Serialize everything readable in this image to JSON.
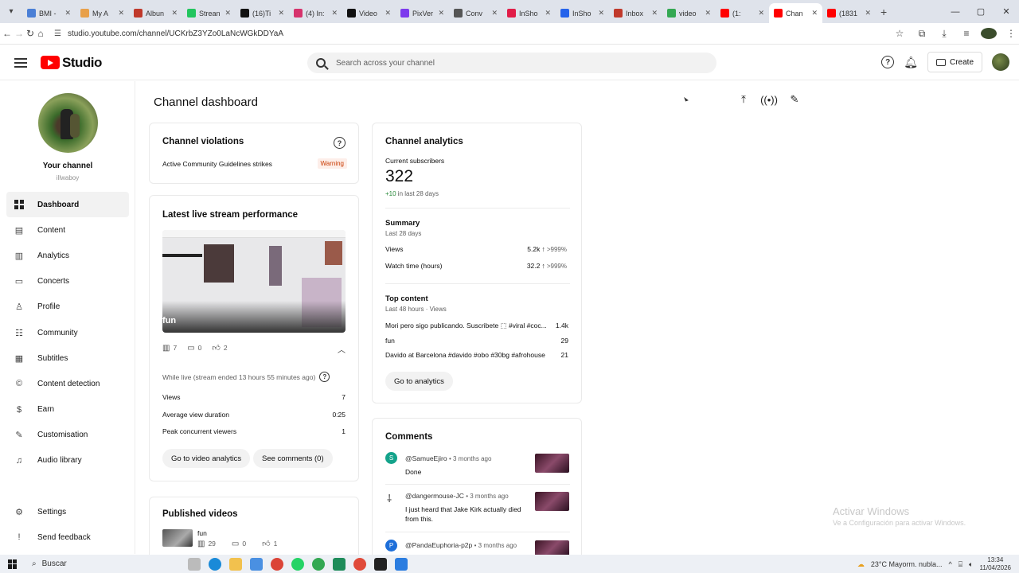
{
  "browser": {
    "tabs": [
      {
        "label": "BMI -",
        "color": "#4a7fd6",
        "active": false
      },
      {
        "label": "My A",
        "color": "#e8a04a",
        "active": false
      },
      {
        "label": "Albun",
        "color": "#c0392b",
        "active": false
      },
      {
        "label": "Strean",
        "color": "#22c55e",
        "active": false
      },
      {
        "label": "(16)Ti",
        "color": "#111111",
        "active": false
      },
      {
        "label": "(4) In:",
        "color": "#d6336c",
        "active": false
      },
      {
        "label": "Video",
        "color": "#111111",
        "active": false
      },
      {
        "label": "PixVer",
        "color": "#7c3aed",
        "active": false
      },
      {
        "label": "Conv",
        "color": "#555555",
        "active": false
      },
      {
        "label": "InSho",
        "color": "#e11d48",
        "active": false
      },
      {
        "label": "InSho",
        "color": "#2563eb",
        "active": false
      },
      {
        "label": "Inbox",
        "color": "#c0392b",
        "active": false
      },
      {
        "label": "video",
        "color": "#34a853",
        "active": false
      },
      {
        "label": "(1:",
        "color": "#ff0000",
        "active": false
      },
      {
        "label": "Chan",
        "color": "#ff0000",
        "active": true
      },
      {
        "label": "(1831",
        "color": "#ff0000",
        "active": false
      }
    ],
    "url": "studio.youtube.com/channel/UCKrbZ3YZo0LaNcWGkDDYaA"
  },
  "header": {
    "logo_text": "Studio",
    "search_placeholder": "Search across your channel",
    "create_label": "Create"
  },
  "sidebar": {
    "channel_label": "Your channel",
    "handle": "illwaboy",
    "items": [
      {
        "label": "Dashboard",
        "icon": "dashboard-icon",
        "glyph": "",
        "active": true
      },
      {
        "label": "Content",
        "icon": "content-icon",
        "glyph": "▤",
        "active": false
      },
      {
        "label": "Analytics",
        "icon": "analytics-icon",
        "glyph": "▥",
        "active": false
      },
      {
        "label": "Concerts",
        "icon": "concerts-icon",
        "glyph": "▭",
        "active": false
      },
      {
        "label": "Profile",
        "icon": "profile-icon",
        "glyph": "♙",
        "active": false
      },
      {
        "label": "Community",
        "icon": "community-icon",
        "glyph": "☷",
        "active": false
      },
      {
        "label": "Subtitles",
        "icon": "subtitles-icon",
        "glyph": "▦",
        "active": false
      },
      {
        "label": "Content detection",
        "icon": "copyright-icon",
        "glyph": "©",
        "active": false
      },
      {
        "label": "Earn",
        "icon": "earn-icon",
        "glyph": "$",
        "active": false
      },
      {
        "label": "Customisation",
        "icon": "customisation-icon",
        "glyph": "✎",
        "active": false
      },
      {
        "label": "Audio library",
        "icon": "audio-library-icon",
        "glyph": "♫",
        "active": false
      }
    ],
    "bottom_items": [
      {
        "label": "Settings",
        "icon": "settings-icon",
        "glyph": "⚙"
      },
      {
        "label": "Send feedback",
        "icon": "feedback-icon",
        "glyph": "!"
      }
    ]
  },
  "main": {
    "title": "Channel dashboard",
    "violations": {
      "title": "Channel violations",
      "text": "Active Community Guidelines strikes",
      "badge": "Warning"
    },
    "live": {
      "title": "Latest live stream performance",
      "thumb_label": "fun",
      "views_count": "7",
      "comments_count": "0",
      "likes_count": "2",
      "while_live": "While live (stream ended 13 hours 55 minutes ago)",
      "rows": [
        {
          "label": "Views",
          "value": "7"
        },
        {
          "label": "Average view duration",
          "value": "0:25"
        },
        {
          "label": "Peak concurrent viewers",
          "value": "1"
        }
      ],
      "btn_analytics": "Go to video analytics",
      "btn_comments": "See comments (0)"
    },
    "published": {
      "title": "Published videos",
      "video_title": "fun",
      "views": "29",
      "comments": "0",
      "likes": "1"
    },
    "analytics": {
      "title": "Channel analytics",
      "subs_label": "Current subscribers",
      "subs_value": "322",
      "subs_change": "+10",
      "subs_change_suffix": " in last 28 days",
      "summary_title": "Summary",
      "summary_sub": "Last 28 days",
      "summary_rows": [
        {
          "label": "Views",
          "value": "5.2k",
          "change": ">999%"
        },
        {
          "label": "Watch time (hours)",
          "value": "32.2",
          "change": ">999%"
        }
      ],
      "top_title": "Top content",
      "top_sub": "Last 48 hours · Views",
      "top_rows": [
        {
          "label": "Mori pero sigo publicando. Suscribete ⬚ #viral #coc...",
          "value": "1.4k"
        },
        {
          "label": "fun",
          "value": "29"
        },
        {
          "label": "Davido at Barcelona #davido #obo #30bg #afrohouse",
          "value": "21"
        }
      ],
      "btn": "Go to analytics"
    },
    "comments": {
      "title": "Comments",
      "items": [
        {
          "initial": "S",
          "color": "#14a38b",
          "user": "@SamueEjiro",
          "time": "• 3 months ago",
          "text": "Done"
        },
        {
          "initial": "",
          "color": "#ffffff",
          "user": "@dangermouse-JC",
          "time": "• 3 months ago",
          "text": "I just heard that Jake Kirk actually died from this."
        },
        {
          "initial": "P",
          "color": "#1e6fd9",
          "user": "@PandaEuphoria-p2p",
          "time": "• 3 months ago",
          "text": ""
        }
      ]
    }
  },
  "watermark": {
    "line1": "Activar Windows",
    "line2": "Ve a Configuración para activar Windows."
  },
  "taskbar": {
    "search_label": "Buscar",
    "weather": "23°C  Mayorm. nubla...",
    "time": "13:34",
    "date": "11/04/2026"
  }
}
